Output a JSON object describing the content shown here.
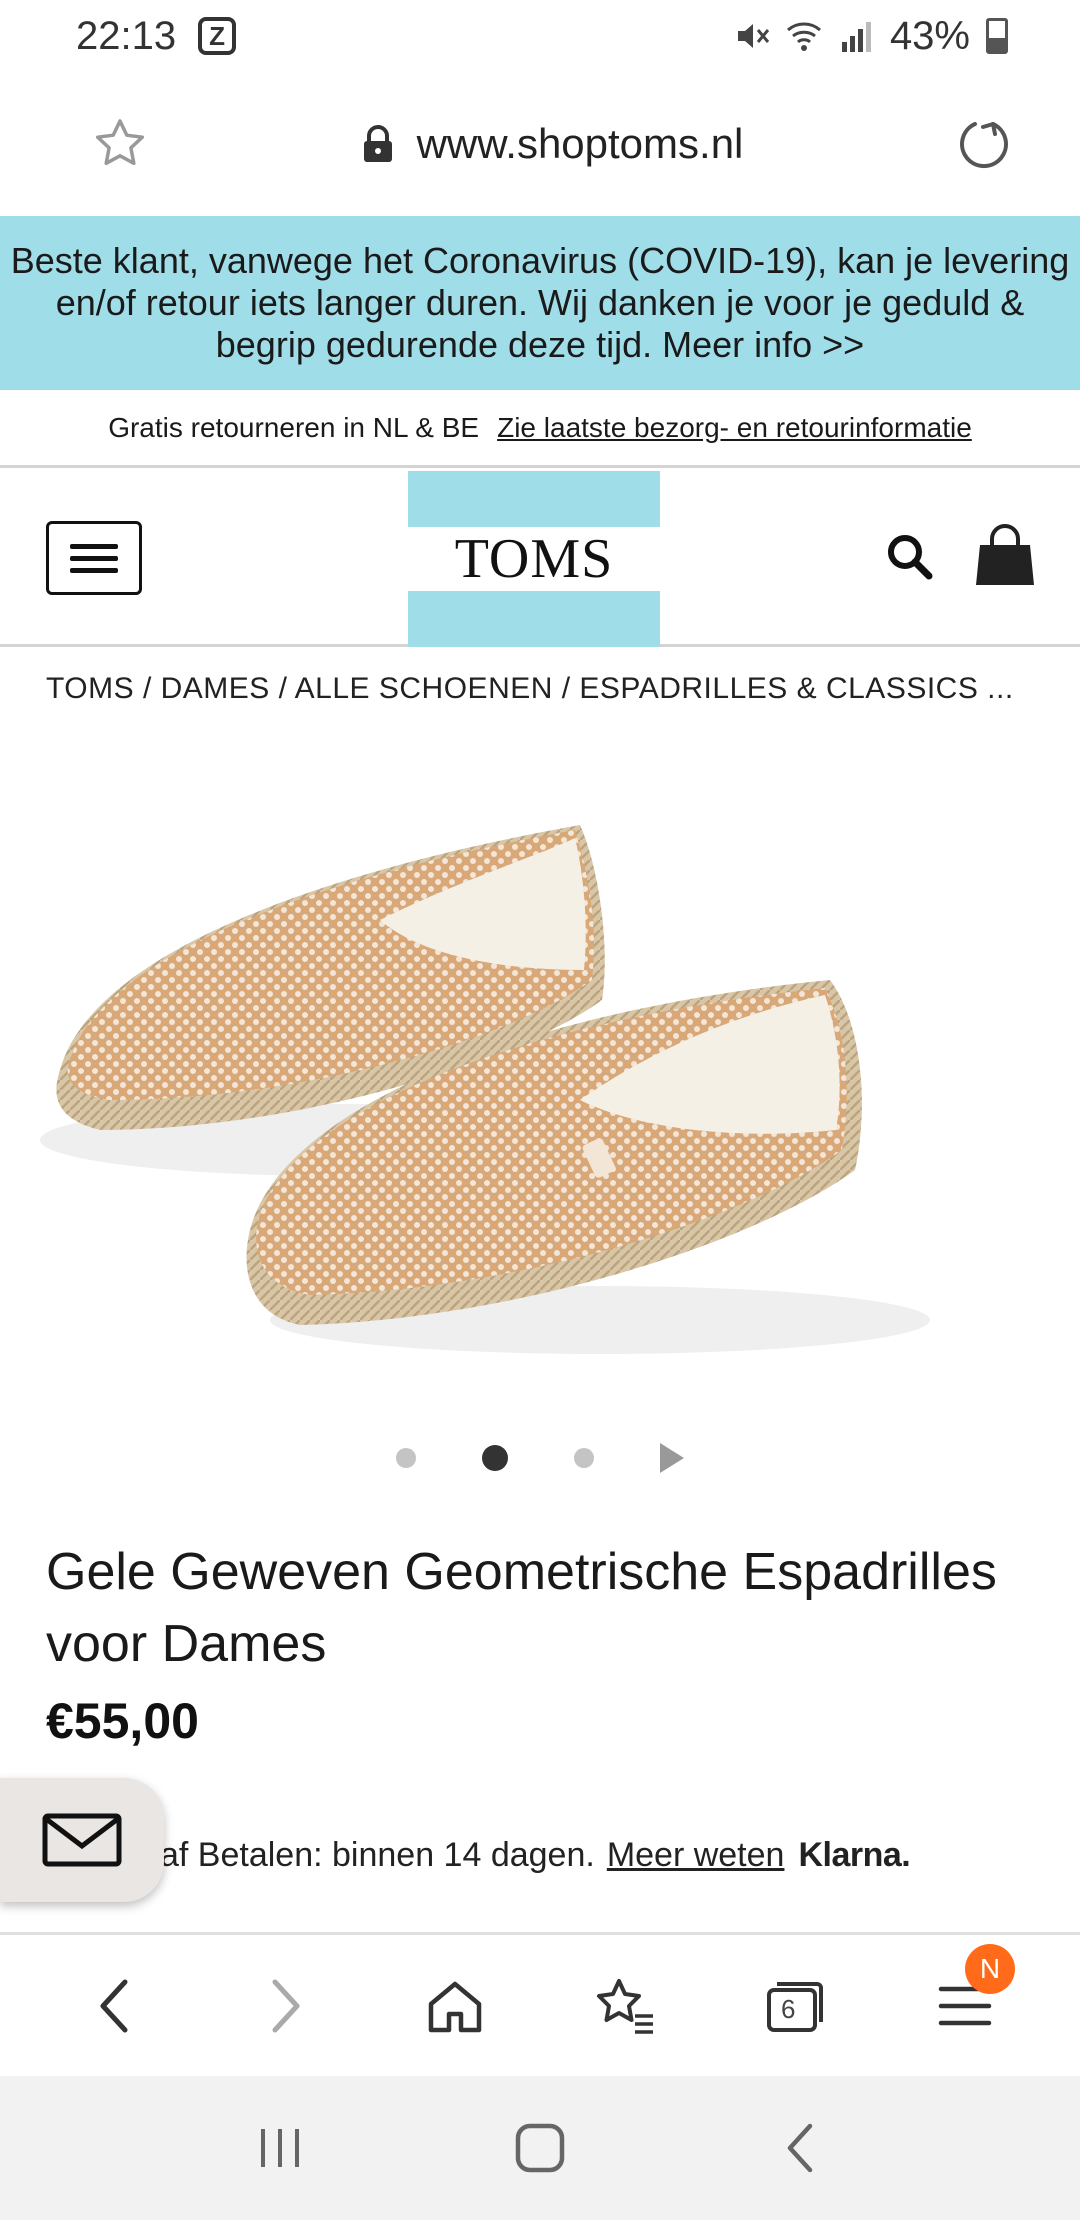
{
  "status_bar": {
    "time": "22:13",
    "notification_letter": "Z",
    "battery": "43%"
  },
  "url_bar": {
    "url": "www.shoptoms.nl"
  },
  "covid_banner": {
    "text": "Beste klant, vanwege het Coronavirus (COVID-19), kan je levering en/of retour iets langer duren. Wij danken je voor je geduld & begrip gedurende deze tijd. Meer info >>"
  },
  "shipping": {
    "text": "Gratis retourneren in NL & BE",
    "link": "Zie laatste bezorg- en retourinformatie"
  },
  "header": {
    "logo": "TOMS"
  },
  "breadcrumb": "TOMS / DAMES / ALLE SCHOENEN / ESPADRILLES & CLASSICS ...",
  "carousel": {
    "total": 3,
    "active_index": 1
  },
  "product": {
    "title": "Gele Geweven Geometrische Espadrilles voor Dames",
    "price": "€55,00"
  },
  "klarna": {
    "text": "af Betalen: binnen 14 dagen.",
    "link": "Meer weten",
    "logo": "Klarna."
  },
  "browser_nav": {
    "tab_count": "6",
    "menu_badge": "N"
  },
  "colors": {
    "banner": "#9fdde8",
    "badge": "#ff6b1a"
  }
}
